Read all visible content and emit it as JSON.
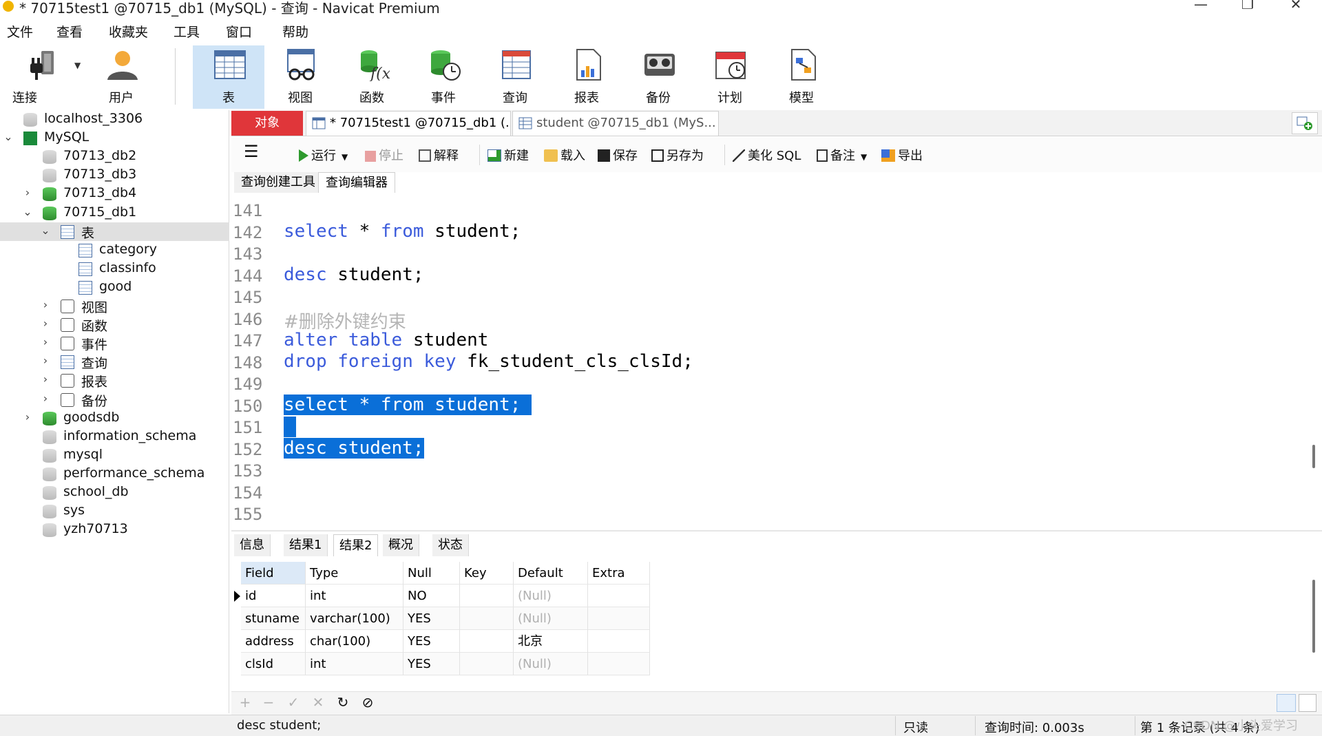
{
  "window": {
    "title": "* 70715test1 @70715_db1 (MySQL) - 查询 - Navicat Premium",
    "minimize": "—",
    "maximize": "❐",
    "close": "✕"
  },
  "menu": [
    "文件",
    "查看",
    "收藏夹",
    "工具",
    "窗口",
    "帮助"
  ],
  "ribbon": {
    "buttons": [
      {
        "label": "连接",
        "icon": "plug-icon"
      },
      {
        "label": "用户",
        "icon": "user-icon"
      },
      {
        "label": "表",
        "icon": "table-icon",
        "active": true
      },
      {
        "label": "视图",
        "icon": "view-icon"
      },
      {
        "label": "函数",
        "icon": "function-icon"
      },
      {
        "label": "事件",
        "icon": "event-icon"
      },
      {
        "label": "查询",
        "icon": "query-icon"
      },
      {
        "label": "报表",
        "icon": "report-icon"
      },
      {
        "label": "备份",
        "icon": "backup-icon"
      },
      {
        "label": "计划",
        "icon": "schedule-icon"
      },
      {
        "label": "模型",
        "icon": "model-icon"
      }
    ]
  },
  "tree": [
    {
      "label": "localhost_3306",
      "level": 0,
      "icon": "connection-icon",
      "chevron": ""
    },
    {
      "label": "MySQL",
      "level": 0,
      "icon": "mysql-icon",
      "chevron": "⌄"
    },
    {
      "label": "70713_db2",
      "level": 1,
      "icon": "database-grey-icon",
      "chevron": ""
    },
    {
      "label": "70713_db3",
      "level": 1,
      "icon": "database-grey-icon",
      "chevron": ""
    },
    {
      "label": "70713_db4",
      "level": 1,
      "icon": "database-green-icon",
      "chevron": "›"
    },
    {
      "label": "70715_db1",
      "level": 1,
      "icon": "database-green-icon",
      "chevron": "⌄"
    },
    {
      "label": "表",
      "level": 2,
      "icon": "table-folder-icon",
      "chevron": "⌄",
      "selected": true
    },
    {
      "label": "category",
      "level": 3,
      "icon": "table-icon",
      "chevron": ""
    },
    {
      "label": "classinfo",
      "level": 3,
      "icon": "table-icon",
      "chevron": ""
    },
    {
      "label": "good",
      "level": 3,
      "icon": "table-icon",
      "chevron": ""
    },
    {
      "label": "视图",
      "level": 2,
      "icon": "view-icon",
      "chevron": "›"
    },
    {
      "label": "函数",
      "level": 2,
      "icon": "function-icon",
      "chevron": "›"
    },
    {
      "label": "事件",
      "level": 2,
      "icon": "event-icon",
      "chevron": "›"
    },
    {
      "label": "查询",
      "level": 2,
      "icon": "query-icon",
      "chevron": "›"
    },
    {
      "label": "报表",
      "level": 2,
      "icon": "report-icon",
      "chevron": "›"
    },
    {
      "label": "备份",
      "level": 2,
      "icon": "backup-icon",
      "chevron": "›"
    },
    {
      "label": "goodsdb",
      "level": 1,
      "icon": "database-green-icon",
      "chevron": "›"
    },
    {
      "label": "information_schema",
      "level": 1,
      "icon": "database-grey-icon",
      "chevron": ""
    },
    {
      "label": "mysql",
      "level": 1,
      "icon": "database-grey-icon",
      "chevron": ""
    },
    {
      "label": "performance_schema",
      "level": 1,
      "icon": "database-grey-icon",
      "chevron": ""
    },
    {
      "label": "school_db",
      "level": 1,
      "icon": "database-grey-icon",
      "chevron": ""
    },
    {
      "label": "sys",
      "level": 1,
      "icon": "database-grey-icon",
      "chevron": ""
    },
    {
      "label": "yzh70713",
      "level": 1,
      "icon": "database-grey-icon",
      "chevron": ""
    }
  ],
  "tabs": {
    "objects": "对象",
    "doc1": "* 70715test1 @70715_db1 (...",
    "doc2": "student @70715_db1 (MyS..."
  },
  "toolbar": {
    "run": "运行",
    "stop": "停止",
    "explain": "解释",
    "new": "新建",
    "load": "载入",
    "save": "保存",
    "save_as": "另存为",
    "beautify": "美化 SQL",
    "comment": "备注",
    "export": "导出"
  },
  "subtabs": [
    "查询创建工具",
    "查询编辑器"
  ],
  "editor": {
    "line_numbers": [
      "141",
      "142",
      "143",
      "144",
      "145",
      "146",
      "147",
      "148",
      "149",
      "150",
      "151",
      "152",
      "153",
      "154",
      "155"
    ]
  },
  "result_tabs": [
    "信息",
    "结果1",
    "结果2",
    "概况",
    "状态"
  ],
  "result_grid": {
    "columns": [
      "Field",
      "Type",
      "Null",
      "Key",
      "Default",
      "Extra"
    ],
    "rows": [
      [
        "id",
        "int",
        "NO",
        "",
        "(Null)",
        ""
      ],
      [
        "stuname",
        "varchar(100)",
        "YES",
        "",
        "(Null)",
        ""
      ],
      [
        "address",
        "char(100)",
        "YES",
        "",
        "北京",
        ""
      ],
      [
        "clsId",
        "int",
        "YES",
        "",
        "(Null)",
        ""
      ]
    ]
  },
  "status": {
    "sql": "desc student;",
    "readonly": "只读",
    "query_time": "查询时间: 0.003s",
    "records": "第 1 条记录 (共 4 条)",
    "watermark": "CSDN @小头爱学习"
  }
}
